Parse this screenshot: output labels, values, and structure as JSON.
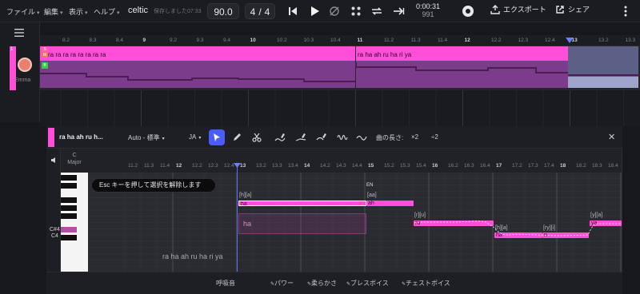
{
  "menu": {
    "file": "ファイル",
    "edit": "編集",
    "view": "表示",
    "help": "ヘルプ",
    "caret": "▾"
  },
  "project": {
    "title": "celtic",
    "saved": "保存しました07:33"
  },
  "transport": {
    "tempo": "90.0",
    "time_sig_num": "4",
    "time_sig_sep": "/",
    "time_sig_den": "4",
    "time": "0:00:31",
    "frames": "991"
  },
  "actions": {
    "export": "エクスポート",
    "share": "シェア"
  },
  "ruler_top": {
    "labels": [
      "8.2",
      "8.3",
      "8.4",
      "9",
      "9.2",
      "9.3",
      "9.4",
      "10",
      "10.2",
      "10.3",
      "10.4",
      "11",
      "11.2",
      "11.3",
      "11.4",
      "12",
      "12.2",
      "12.3",
      "12.4",
      "13",
      "13.2",
      "13.3"
    ],
    "playhead": "13"
  },
  "track": {
    "number": "1",
    "singer": "Emma",
    "blocks": [
      {
        "lyrics": "ra ra ra ra ra ra ra ra"
      },
      {
        "lyrics": "ra ha ah ru ha ri ya"
      }
    ],
    "badges": [
      "S",
      "M",
      "B"
    ]
  },
  "editor": {
    "clip_title": "ra ha ah ru h...",
    "mode": "Auto - 標準",
    "language": "JA",
    "song_length_label": "曲の長さ:",
    "times_two": "×2",
    "divide_two": "÷2",
    "key_label": "C",
    "scale_label": "Major",
    "tooltip": "Esc キーを押して選択を解除します",
    "close": "✕"
  },
  "ruler_editor": {
    "labels": [
      "11.2",
      "11.3",
      "11.4",
      "12",
      "12.2",
      "12.3",
      "12.4",
      "13",
      "13.2",
      "13.3",
      "13.4",
      "14",
      "14.2",
      "14.3",
      "14.4",
      "15",
      "15.2",
      "15.3",
      "15.4",
      "16",
      "16.2",
      "16.3",
      "16.4",
      "17",
      "17.2",
      "17.3",
      "17.4",
      "18",
      "18.2",
      "18.3",
      "18.4"
    ]
  },
  "piano_roll": {
    "note_labels": [
      "C#4",
      "C4"
    ],
    "notes": [
      {
        "lyric": "ha",
        "phoneme": "[h][a]"
      },
      {
        "lyric": "ah",
        "phoneme": "[aa]"
      },
      {
        "lyric": "ru",
        "phoneme": "[r][u]"
      },
      {
        "lyric": "ha",
        "phoneme": "[h][a]"
      },
      {
        "lyric": "ri",
        "phoneme": "[ry][i]"
      },
      {
        "lyric": "ya",
        "phoneme": "[y][a]"
      }
    ],
    "ghost_note": "ha",
    "en_marker": "EN",
    "lyric_preview": "ra ha ah ru ha ri ya"
  },
  "bottom": {
    "breath": "呼吸音",
    "power": "パワー",
    "softness": "柔らかさ",
    "breathy": "ブレスボイス",
    "chest": "チェストボイス"
  },
  "colors": {
    "accent": "#ff4fd8",
    "select": "#4b5cff",
    "bg": "#17181c"
  }
}
